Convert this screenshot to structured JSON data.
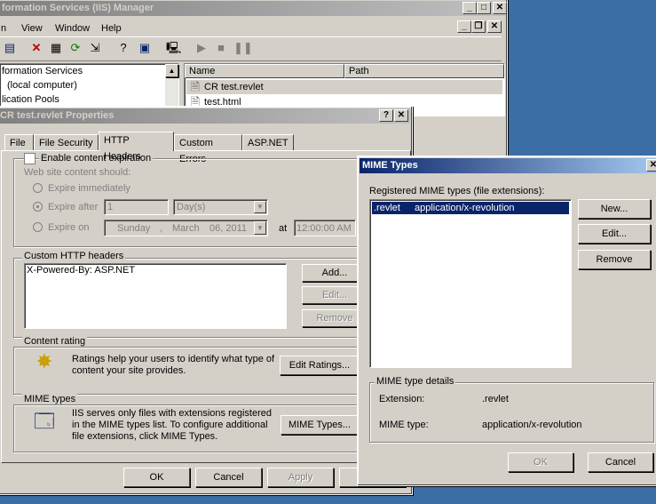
{
  "iis": {
    "title": "formation Services (IIS) Manager",
    "menu": [
      "n",
      "View",
      "Window",
      "Help"
    ],
    "tree": [
      "formation Services",
      "(local computer)",
      "lication Pools"
    ],
    "columns": [
      "Name",
      "Path"
    ],
    "files": [
      "CR test.revlet",
      "test.html"
    ]
  },
  "props": {
    "title": "CR test.revlet Properties",
    "help_btn": "?",
    "tabs": [
      "File",
      "File Security",
      "HTTP Headers",
      "Custom Errors",
      "ASP.NET"
    ],
    "expiration": {
      "checkbox_label": "Enable content expiration",
      "should_label": "Web site content should:",
      "immediately": "Expire immediately",
      "after": "Expire after",
      "after_value": "1",
      "after_unit": "Day(s)",
      "on": "Expire on",
      "date_day": "Sunday",
      "date_sep1": ",",
      "date_month": "March",
      "date_rest": "06, 2011",
      "at": "at",
      "time": "12:00:00 AM"
    },
    "custom_headers": {
      "label": "Custom HTTP headers",
      "items": [
        "X-Powered-By: ASP.NET"
      ],
      "add": "Add...",
      "edit": "Edit...",
      "remove": "Remove"
    },
    "rating": {
      "label": "Content rating",
      "text": "Ratings help your users to identify what type of content your site provides.",
      "button": "Edit Ratings..."
    },
    "mime": {
      "label": "MIME types",
      "text": "IIS serves only files with extensions registered in the MIME types list. To configure additional file extensions, click MIME Types.",
      "button": "MIME Types..."
    },
    "ok": "OK",
    "cancel": "Cancel",
    "apply": "Apply"
  },
  "mime_dialog": {
    "title": "MIME Types",
    "registered_label": "Registered MIME types (file extensions):",
    "items": [
      {
        "ext": ".revlet",
        "type": "application/x-revolution"
      }
    ],
    "new": "New...",
    "edit": "Edit...",
    "remove": "Remove",
    "details_label": "MIME type details",
    "extension_label": "Extension:",
    "extension_value": ".revlet",
    "type_label": "MIME type:",
    "type_value": "application/x-revolution",
    "ok": "OK",
    "cancel": "Cancel"
  }
}
